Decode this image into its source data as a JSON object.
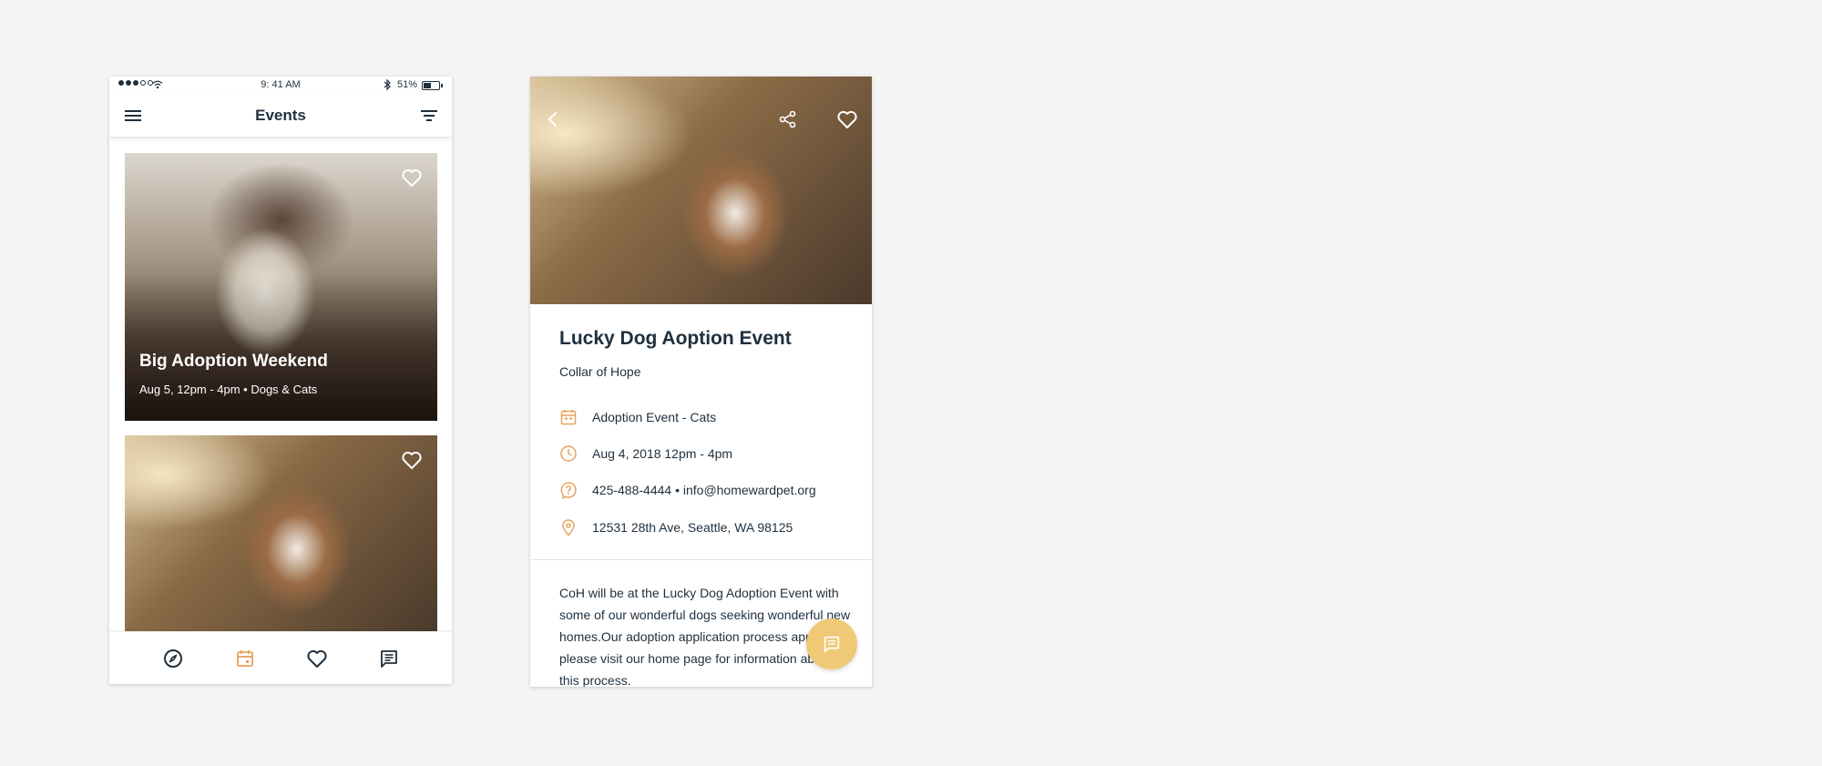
{
  "list_screen": {
    "status_bar": {
      "time": "9: 41 AM",
      "battery_pct": "51%"
    },
    "appbar": {
      "title": "Events"
    },
    "events": [
      {
        "title": "Big Adoption Weekend",
        "subtitle": "Aug 5, 12pm - 4pm • Dogs & Cats"
      },
      {
        "title": "",
        "subtitle": ""
      }
    ],
    "bottom_nav": [
      {
        "icon": "compass-icon"
      },
      {
        "icon": "calendar-icon",
        "active": true
      },
      {
        "icon": "heart-icon"
      },
      {
        "icon": "chat-icon"
      }
    ]
  },
  "detail_screen": {
    "title": "Lucky Dog Aoption Event",
    "org": "Collar of Hope",
    "info": {
      "type": "Adoption Event - Cats",
      "datetime": "Aug 4, 2018 12pm - 4pm",
      "contact": "425-488-4444 • info@homewardpet.org",
      "address": "12531 28th Ave, Seattle, WA 98125"
    },
    "description": "CoH will be at the Lucky Dog Adoption Event with some of our wonderful dogs seeking wonderful new homes.Our adoption application process applies so please visit our home page for information about this process."
  },
  "colors": {
    "accent": "#e8a15c",
    "fab": "#f0c976",
    "text": "#1f2f3d",
    "background": "#f4f4f4"
  }
}
